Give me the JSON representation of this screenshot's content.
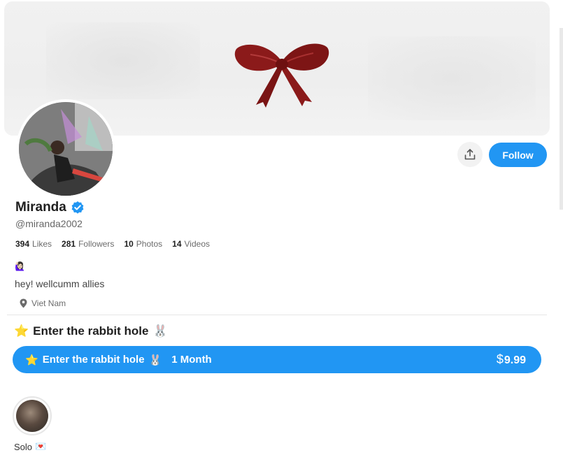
{
  "profile": {
    "name": "Miranda",
    "handle": "@miranda2002",
    "verified": true,
    "bio_emoji": "🙋🏻‍♀️",
    "bio": "hey! wellcumm allies",
    "location": "Viet Nam"
  },
  "stats": [
    {
      "num": "394",
      "label": "Likes"
    },
    {
      "num": "281",
      "label": "Followers"
    },
    {
      "num": "10",
      "label": "Photos"
    },
    {
      "num": "14",
      "label": "Videos"
    }
  ],
  "actions": {
    "follow_label": "Follow"
  },
  "subscription": {
    "title_star": "⭐",
    "title": "Enter the rabbit hole",
    "title_emoji": "🐰",
    "button_star": "⭐",
    "button_title": "Enter the rabbit hole",
    "button_emoji": "🐰",
    "duration": "1 Month",
    "currency": "$",
    "price": "9.99"
  },
  "stories": [
    {
      "label": "Solo",
      "emoji": "💌"
    }
  ],
  "colors": {
    "accent": "#2196f3",
    "verified": "#2196f3",
    "bow": "#8b1a1a"
  }
}
